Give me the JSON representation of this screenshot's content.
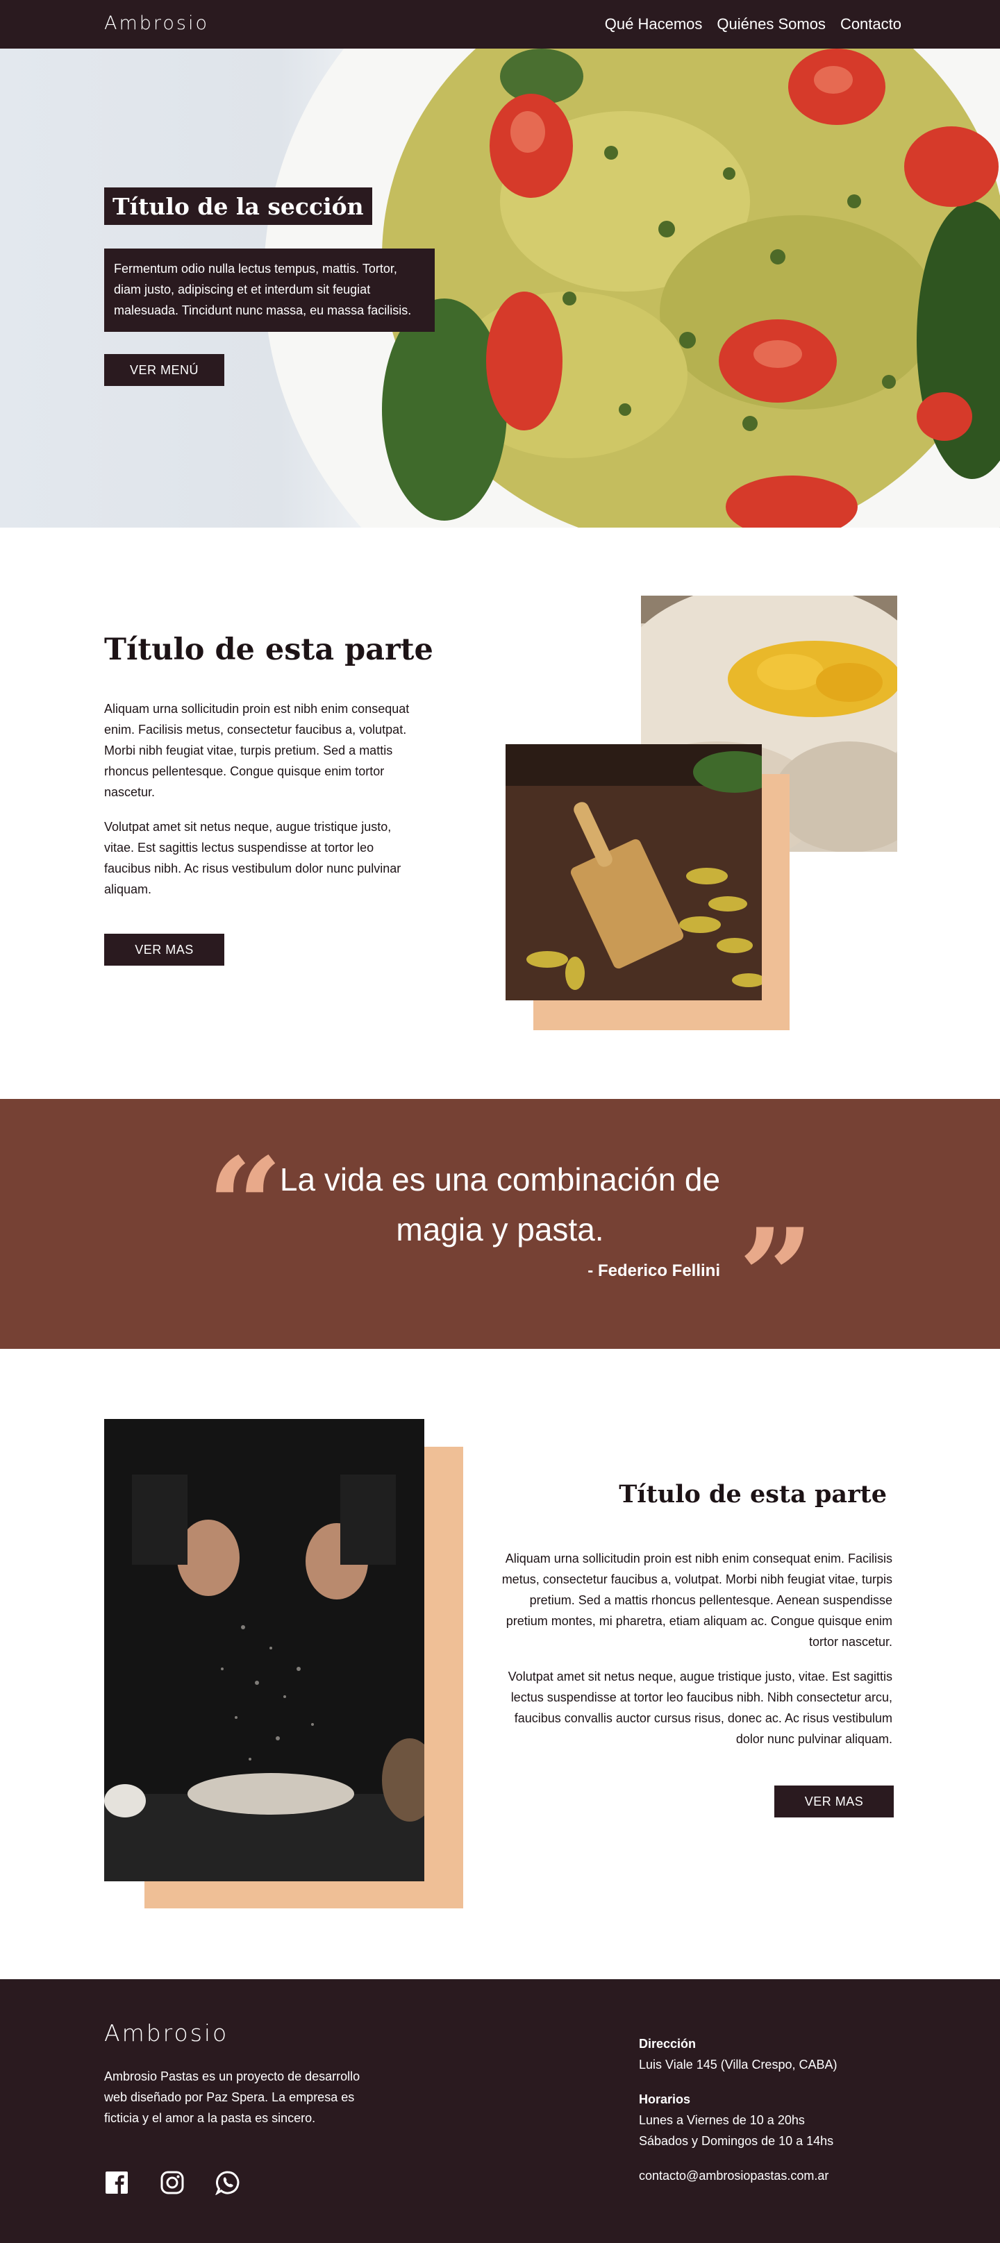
{
  "nav": {
    "brand": "Ambrosio",
    "links": [
      "Qué Hacemos",
      "Quiénes Somos",
      "Contacto"
    ]
  },
  "hero": {
    "title": "Título de la sección",
    "text": "Fermentum odio nulla lectus tempus, mattis. Tortor, diam justo, adipiscing et et interdum sit feugiat malesuada. Tincidunt nunc massa, eu massa facilisis.",
    "button": "VER MENÚ"
  },
  "section2": {
    "title": "Título de esta parte",
    "paragraphs": [
      "Aliquam urna sollicitudin proin est nibh enim consequat enim. Facilisis metus, consectetur faucibus a, volutpat. Morbi nibh feugiat vitae, turpis pretium. Sed a mattis rhoncus pellentesque. Congue quisque enim tortor nascetur.",
      "Volutpat amet sit netus neque, augue tristique justo, vitae. Est sagittis lectus suspendisse at tortor leo faucibus nibh. Ac risus vestibulum dolor nunc pulvinar aliquam."
    ],
    "button": "VER MAS"
  },
  "quote": {
    "text": "La vida es una combinación de magia y pasta.",
    "author": "- Federico Fellini"
  },
  "section4": {
    "title": "Título de esta parte",
    "paragraphs": [
      "Aliquam urna sollicitudin proin est nibh enim consequat enim. Facilisis metus, consectetur faucibus a, volutpat. Morbi nibh feugiat vitae, turpis pretium. Sed a mattis rhoncus pellentesque. Aenean suspendisse pretium montes, mi pharetra, etiam aliquam ac. Congue quisque enim tortor nascetur.",
      "Volutpat amet sit netus neque, augue tristique justo, vitae. Est sagittis lectus suspendisse at tortor leo faucibus nibh. Nibh consectetur arcu, faucibus convallis auctor cursus risus, donec ac. Ac risus vestibulum dolor nunc pulvinar aliquam."
    ],
    "button": "VER MAS"
  },
  "footer": {
    "brand": "Ambrosio",
    "about": "Ambrosio Pastas es un proyecto de desarrollo web diseñado por Paz Spera. La empresa es ficticia y el amor a la pasta es sincero.",
    "social_icons": [
      "facebook-icon",
      "instagram-icon",
      "whatsapp-icon"
    ],
    "address_label": "Dirección",
    "address": "Luis Viale 145 (Villa Crespo, CABA)",
    "hours_label": "Horarios",
    "hours_weekdays": "Lunes a Viernes de 10 a 20hs",
    "hours_weekend": "Sábados y Domingos de 10 a 14hs",
    "email": "contacto@ambrosiopastas.com.ar"
  },
  "colors": {
    "dark": "#2a1a1f",
    "accent_peach": "#efbf96",
    "quote_bg": "#764134",
    "quote_marks": "#e8a98a"
  }
}
